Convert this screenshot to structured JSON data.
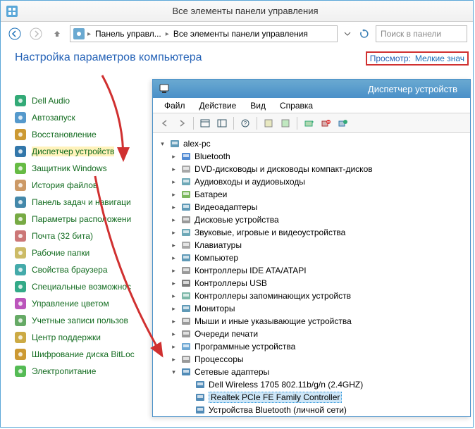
{
  "window": {
    "title": "Все элементы панели управления",
    "breadcrumbs": [
      "Панель управл...",
      "Все элементы панели управления"
    ],
    "search_placeholder": "Поиск в панели"
  },
  "main": {
    "heading": "Настройка параметров компьютера",
    "view_label": "Просмотр:",
    "view_value": "Мелкие знач"
  },
  "control_panel_items": [
    {
      "label": "Dell Audio",
      "icon": "speaker"
    },
    {
      "label": "Автозапуск",
      "icon": "disc"
    },
    {
      "label": "Восстановление",
      "icon": "restore"
    },
    {
      "label": "Диспетчер устройств",
      "icon": "device-mgr",
      "highlight": true
    },
    {
      "label": "Защитник Windows",
      "icon": "shield"
    },
    {
      "label": "История файлов",
      "icon": "history"
    },
    {
      "label": "Панель задач и навигаци",
      "icon": "taskbar"
    },
    {
      "label": "Параметры расположени",
      "icon": "location"
    },
    {
      "label": "Почта (32 бита)",
      "icon": "mail"
    },
    {
      "label": "Рабочие папки",
      "icon": "folder"
    },
    {
      "label": "Свойства браузера",
      "icon": "globe"
    },
    {
      "label": "Специальные возможнос",
      "icon": "access"
    },
    {
      "label": "Управление цветом",
      "icon": "color"
    },
    {
      "label": "Учетные записи пользов",
      "icon": "user"
    },
    {
      "label": "Центр поддержки",
      "icon": "flag"
    },
    {
      "label": "Шифрование диска BitLoc",
      "icon": "lock"
    },
    {
      "label": "Электропитание",
      "icon": "power"
    }
  ],
  "device_manager": {
    "title": "Диспетчер устройств",
    "menu": [
      "Файл",
      "Действие",
      "Вид",
      "Справка"
    ],
    "root": "alex-pc",
    "nodes": [
      {
        "label": "Bluetooth",
        "icon": "bluetooth"
      },
      {
        "label": "DVD-дисководы и дисководы компакт-дисков",
        "icon": "disc"
      },
      {
        "label": "Аудиовходы и аудиовыходы",
        "icon": "audio"
      },
      {
        "label": "Батареи",
        "icon": "battery"
      },
      {
        "label": "Видеоадаптеры",
        "icon": "display"
      },
      {
        "label": "Дисковые устройства",
        "icon": "disk"
      },
      {
        "label": "Звуковые, игровые и видеоустройства",
        "icon": "sound"
      },
      {
        "label": "Клавиатуры",
        "icon": "keyboard"
      },
      {
        "label": "Компьютер",
        "icon": "computer"
      },
      {
        "label": "Контроллеры IDE ATA/ATAPI",
        "icon": "ide"
      },
      {
        "label": "Контроллеры USB",
        "icon": "usb"
      },
      {
        "label": "Контроллеры запоминающих устройств",
        "icon": "storage"
      },
      {
        "label": "Мониторы",
        "icon": "monitor"
      },
      {
        "label": "Мыши и иные указывающие устройства",
        "icon": "mouse"
      },
      {
        "label": "Очереди печати",
        "icon": "printer"
      },
      {
        "label": "Программные устройства",
        "icon": "software"
      },
      {
        "label": "Процессоры",
        "icon": "cpu"
      },
      {
        "label": "Сетевые адаптеры",
        "icon": "network",
        "expanded": true,
        "children": [
          {
            "label": "Dell Wireless 1705 802.11b/g/n (2.4GHZ)",
            "icon": "net-adapter"
          },
          {
            "label": "Realtek PCIe FE Family Controller",
            "icon": "net-adapter",
            "selected": true
          },
          {
            "label": "Устройства Bluetooth (личной сети)",
            "icon": "net-adapter"
          }
        ]
      }
    ]
  }
}
